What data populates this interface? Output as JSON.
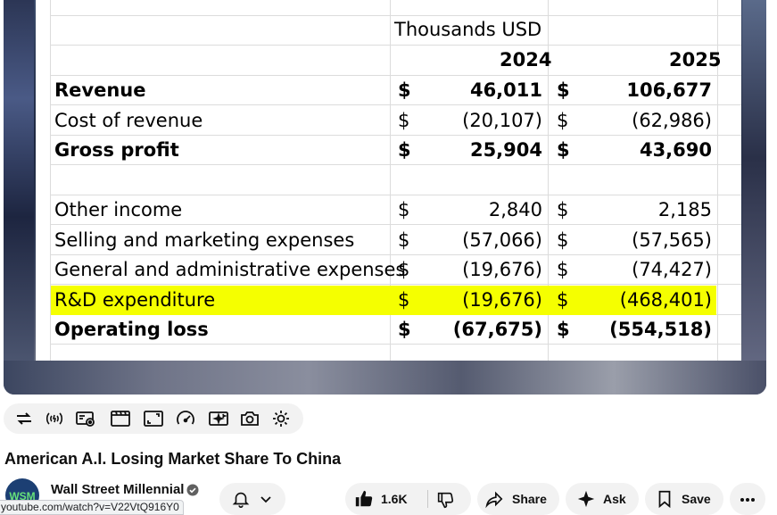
{
  "table": {
    "unit_header": "Thousands USD",
    "years": [
      "2024",
      "2025"
    ],
    "rows": [
      {
        "label": "Revenue",
        "cur1": "$",
        "v2024": "46,011",
        "cur2": "$",
        "v2025": "106,677",
        "bold": true
      },
      {
        "label": "Cost of revenue",
        "cur1": "$",
        "v2024": "(20,107)",
        "cur2": "$",
        "v2025": "(62,986)",
        "bold": false
      },
      {
        "label": "Gross profit",
        "cur1": "$",
        "v2024": "25,904",
        "cur2": "$",
        "v2025": "43,690",
        "bold": true
      },
      {
        "label": "",
        "cur1": "",
        "v2024": "",
        "cur2": "",
        "v2025": "",
        "bold": false
      },
      {
        "label": "Other income",
        "cur1": "$",
        "v2024": "2,840",
        "cur2": "$",
        "v2025": "2,185",
        "bold": false
      },
      {
        "label": "Selling and marketing expenses",
        "cur1": "$",
        "v2024": "(57,066)",
        "cur2": "$",
        "v2025": "(57,565)",
        "bold": false
      },
      {
        "label": "General and administrative expenses",
        "cur1": "$",
        "v2024": "(19,676)",
        "cur2": "$",
        "v2025": "(74,427)",
        "bold": false
      },
      {
        "label": "R&D expenditure",
        "cur1": "$",
        "v2024": "(19,676)",
        "cur2": "$",
        "v2025": "(468,401)",
        "bold": false,
        "highlight": true
      },
      {
        "label": "Operating loss",
        "cur1": "$",
        "v2024": "(67,675)",
        "cur2": "$",
        "v2025": "(554,518)",
        "bold": true
      }
    ],
    "highlight_color": "#f5ff00"
  },
  "controls": {
    "icons": [
      "loop-icon",
      "stable-volume-icon",
      "ambient-mode-icon",
      "chapters-icon",
      "theater-mode-icon",
      "playback-speed-icon",
      "ai-effects-icon",
      "screenshot-icon",
      "settings-gear-icon"
    ]
  },
  "video": {
    "title": "American A.I. Losing Market Share To China"
  },
  "channel": {
    "name": "Wall Street Millennial",
    "avatar_text": "WSM"
  },
  "actions": {
    "like_count": "1.6K",
    "share_label": "Share",
    "ask_label": "Ask",
    "save_label": "Save"
  },
  "status_url": "youtube.com/watch?v=V22VtQ916Y0"
}
